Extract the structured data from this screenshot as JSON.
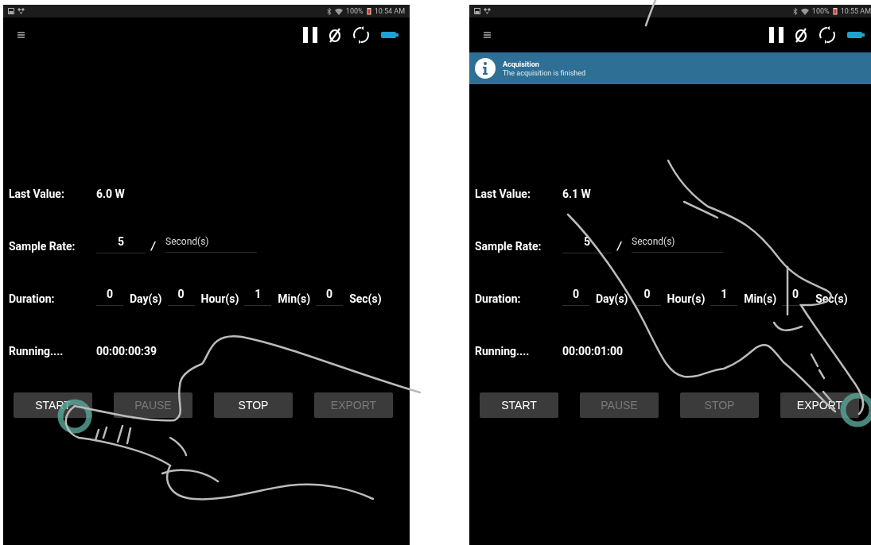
{
  "screens": [
    {
      "status_bar": {
        "battery": "100%",
        "time": "10:54 AM"
      },
      "last_value": {
        "label": "Last Value:",
        "value": "6.0 W"
      },
      "sample_rate": {
        "label": "Sample Rate:",
        "value": "5",
        "separator": "/",
        "unit": "Second(s)"
      },
      "duration": {
        "label": "Duration:",
        "fields": [
          {
            "value": "0",
            "unit": "Day(s)"
          },
          {
            "value": "0",
            "unit": "Hour(s)"
          },
          {
            "value": "1",
            "unit": "Min(s)"
          },
          {
            "value": "0",
            "unit": "Sec(s)"
          }
        ]
      },
      "running": {
        "label": "Running....",
        "elapsed": "00:00:00:39"
      },
      "buttons": [
        {
          "label": "START",
          "disabled": false,
          "touched": true
        },
        {
          "label": "PAUSE",
          "disabled": true,
          "touched": false
        },
        {
          "label": "STOP",
          "disabled": false,
          "touched": false
        },
        {
          "label": "EXPORT",
          "disabled": true,
          "touched": false
        }
      ],
      "hand": {
        "kind": "left"
      }
    },
    {
      "status_bar": {
        "battery": "100%",
        "time": "10:55 AM"
      },
      "banner": {
        "title": "Acquisition",
        "message": "The acquisition is finished"
      },
      "last_value": {
        "label": "Last Value:",
        "value": "6.1 W"
      },
      "sample_rate": {
        "label": "Sample Rate:",
        "value": "5",
        "separator": "/",
        "unit": "Second(s)"
      },
      "duration": {
        "label": "Duration:",
        "fields": [
          {
            "value": "0",
            "unit": "Day(s)"
          },
          {
            "value": "0",
            "unit": "Hour(s)"
          },
          {
            "value": "1",
            "unit": "Min(s)"
          },
          {
            "value": "0",
            "unit": "Sec(s)"
          }
        ]
      },
      "running": {
        "label": "Running....",
        "elapsed": "00:00:01:00"
      },
      "buttons": [
        {
          "label": "START",
          "disabled": false,
          "touched": false
        },
        {
          "label": "PAUSE",
          "disabled": true,
          "touched": false
        },
        {
          "label": "STOP",
          "disabled": true,
          "touched": false
        },
        {
          "label": "EXPORT",
          "disabled": false,
          "touched": true
        }
      ],
      "hand": {
        "kind": "top"
      }
    }
  ]
}
